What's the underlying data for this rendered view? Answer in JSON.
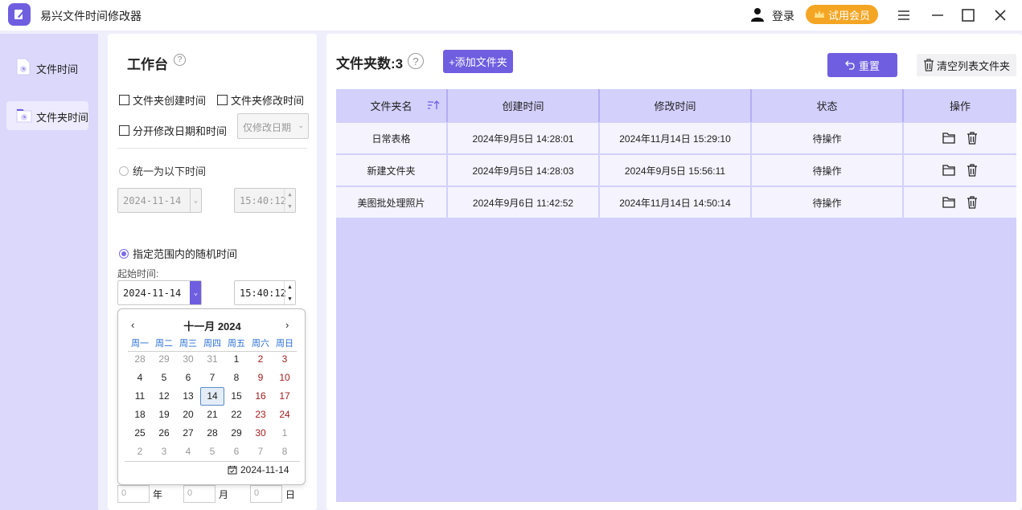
{
  "app": {
    "title": "易兴文件时间修改器"
  },
  "header": {
    "login": "登录",
    "vip": "试用会员"
  },
  "nav": {
    "items": [
      {
        "label": "文件时间"
      },
      {
        "label": "文件夹时间"
      }
    ]
  },
  "panel": {
    "title": "工作台",
    "help": "?",
    "check_created": "文件夹创建时间",
    "check_modified": "文件夹修改时间",
    "check_split": "分开修改日期和时间",
    "split_select": "仅修改日期",
    "radio_unify": "统一为以下时间",
    "unify_date": "2024-11-14",
    "unify_time": "15:40:12",
    "radio_random": "指定范围内的随机时间",
    "start_label": "起始时间:",
    "start_date": "2024-11-14",
    "start_time": "15:40:12",
    "offset": {
      "v1": "0",
      "u1": "年",
      "v2": "0",
      "u2": "月",
      "v3": "0",
      "u3": "日"
    }
  },
  "calendar": {
    "prev": "‹",
    "next": "›",
    "title": "十一月  2024",
    "weekdays": [
      "周一",
      "周二",
      "周三",
      "周四",
      "周五",
      "周六",
      "周日"
    ],
    "weeks": [
      [
        "28",
        "29",
        "30",
        "31",
        "1",
        "2",
        "3"
      ],
      [
        "4",
        "5",
        "6",
        "7",
        "8",
        "9",
        "10"
      ],
      [
        "11",
        "12",
        "13",
        "14",
        "15",
        "16",
        "17"
      ],
      [
        "18",
        "19",
        "20",
        "21",
        "22",
        "23",
        "24"
      ],
      [
        "25",
        "26",
        "27",
        "28",
        "29",
        "30",
        "1"
      ],
      [
        "2",
        "3",
        "4",
        "5",
        "6",
        "7",
        "8"
      ]
    ],
    "selected": "14",
    "today_label": "2024-11-14"
  },
  "main": {
    "folder_count": "文件夹数:3",
    "help": "?",
    "add_button": "+添加文件夹",
    "reset_button": "重置",
    "clear_button": "清空列表文件夹",
    "columns": [
      "文件夹名",
      "创建时间",
      "修改时间",
      "状态",
      "操作"
    ],
    "rows": [
      {
        "name": "日常表格",
        "created": "2024年9月5日 14:28:01",
        "modified": "2024年11月14日 15:29:10",
        "status": "待操作"
      },
      {
        "name": "新建文件夹",
        "created": "2024年9月5日 14:28:03",
        "modified": "2024年9月5日 15:56:11",
        "status": "待操作"
      },
      {
        "name": "美图批处理照片",
        "created": "2024年9月6日 11:42:52",
        "modified": "2024年11月14日 14:50:14",
        "status": "待操作"
      }
    ]
  },
  "colors": {
    "accent": "#6f5ee0",
    "vip": "#f5a524",
    "table_bg": "#d3d0fc",
    "weekend": "#a11d1d"
  }
}
